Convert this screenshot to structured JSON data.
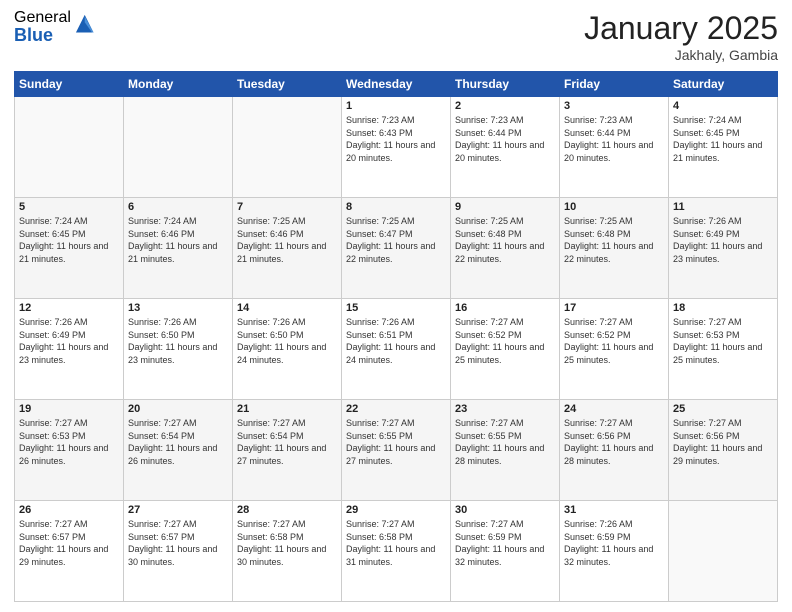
{
  "logo": {
    "general": "General",
    "blue": "Blue"
  },
  "header": {
    "month": "January 2025",
    "location": "Jakhaly, Gambia"
  },
  "weekdays": [
    "Sunday",
    "Monday",
    "Tuesday",
    "Wednesday",
    "Thursday",
    "Friday",
    "Saturday"
  ],
  "weeks": [
    [
      {
        "day": "",
        "sunrise": "",
        "sunset": "",
        "daylight": ""
      },
      {
        "day": "",
        "sunrise": "",
        "sunset": "",
        "daylight": ""
      },
      {
        "day": "",
        "sunrise": "",
        "sunset": "",
        "daylight": ""
      },
      {
        "day": "1",
        "sunrise": "Sunrise: 7:23 AM",
        "sunset": "Sunset: 6:43 PM",
        "daylight": "Daylight: 11 hours and 20 minutes."
      },
      {
        "day": "2",
        "sunrise": "Sunrise: 7:23 AM",
        "sunset": "Sunset: 6:44 PM",
        "daylight": "Daylight: 11 hours and 20 minutes."
      },
      {
        "day": "3",
        "sunrise": "Sunrise: 7:23 AM",
        "sunset": "Sunset: 6:44 PM",
        "daylight": "Daylight: 11 hours and 20 minutes."
      },
      {
        "day": "4",
        "sunrise": "Sunrise: 7:24 AM",
        "sunset": "Sunset: 6:45 PM",
        "daylight": "Daylight: 11 hours and 21 minutes."
      }
    ],
    [
      {
        "day": "5",
        "sunrise": "Sunrise: 7:24 AM",
        "sunset": "Sunset: 6:45 PM",
        "daylight": "Daylight: 11 hours and 21 minutes."
      },
      {
        "day": "6",
        "sunrise": "Sunrise: 7:24 AM",
        "sunset": "Sunset: 6:46 PM",
        "daylight": "Daylight: 11 hours and 21 minutes."
      },
      {
        "day": "7",
        "sunrise": "Sunrise: 7:25 AM",
        "sunset": "Sunset: 6:46 PM",
        "daylight": "Daylight: 11 hours and 21 minutes."
      },
      {
        "day": "8",
        "sunrise": "Sunrise: 7:25 AM",
        "sunset": "Sunset: 6:47 PM",
        "daylight": "Daylight: 11 hours and 22 minutes."
      },
      {
        "day": "9",
        "sunrise": "Sunrise: 7:25 AM",
        "sunset": "Sunset: 6:48 PM",
        "daylight": "Daylight: 11 hours and 22 minutes."
      },
      {
        "day": "10",
        "sunrise": "Sunrise: 7:25 AM",
        "sunset": "Sunset: 6:48 PM",
        "daylight": "Daylight: 11 hours and 22 minutes."
      },
      {
        "day": "11",
        "sunrise": "Sunrise: 7:26 AM",
        "sunset": "Sunset: 6:49 PM",
        "daylight": "Daylight: 11 hours and 23 minutes."
      }
    ],
    [
      {
        "day": "12",
        "sunrise": "Sunrise: 7:26 AM",
        "sunset": "Sunset: 6:49 PM",
        "daylight": "Daylight: 11 hours and 23 minutes."
      },
      {
        "day": "13",
        "sunrise": "Sunrise: 7:26 AM",
        "sunset": "Sunset: 6:50 PM",
        "daylight": "Daylight: 11 hours and 23 minutes."
      },
      {
        "day": "14",
        "sunrise": "Sunrise: 7:26 AM",
        "sunset": "Sunset: 6:50 PM",
        "daylight": "Daylight: 11 hours and 24 minutes."
      },
      {
        "day": "15",
        "sunrise": "Sunrise: 7:26 AM",
        "sunset": "Sunset: 6:51 PM",
        "daylight": "Daylight: 11 hours and 24 minutes."
      },
      {
        "day": "16",
        "sunrise": "Sunrise: 7:27 AM",
        "sunset": "Sunset: 6:52 PM",
        "daylight": "Daylight: 11 hours and 25 minutes."
      },
      {
        "day": "17",
        "sunrise": "Sunrise: 7:27 AM",
        "sunset": "Sunset: 6:52 PM",
        "daylight": "Daylight: 11 hours and 25 minutes."
      },
      {
        "day": "18",
        "sunrise": "Sunrise: 7:27 AM",
        "sunset": "Sunset: 6:53 PM",
        "daylight": "Daylight: 11 hours and 25 minutes."
      }
    ],
    [
      {
        "day": "19",
        "sunrise": "Sunrise: 7:27 AM",
        "sunset": "Sunset: 6:53 PM",
        "daylight": "Daylight: 11 hours and 26 minutes."
      },
      {
        "day": "20",
        "sunrise": "Sunrise: 7:27 AM",
        "sunset": "Sunset: 6:54 PM",
        "daylight": "Daylight: 11 hours and 26 minutes."
      },
      {
        "day": "21",
        "sunrise": "Sunrise: 7:27 AM",
        "sunset": "Sunset: 6:54 PM",
        "daylight": "Daylight: 11 hours and 27 minutes."
      },
      {
        "day": "22",
        "sunrise": "Sunrise: 7:27 AM",
        "sunset": "Sunset: 6:55 PM",
        "daylight": "Daylight: 11 hours and 27 minutes."
      },
      {
        "day": "23",
        "sunrise": "Sunrise: 7:27 AM",
        "sunset": "Sunset: 6:55 PM",
        "daylight": "Daylight: 11 hours and 28 minutes."
      },
      {
        "day": "24",
        "sunrise": "Sunrise: 7:27 AM",
        "sunset": "Sunset: 6:56 PM",
        "daylight": "Daylight: 11 hours and 28 minutes."
      },
      {
        "day": "25",
        "sunrise": "Sunrise: 7:27 AM",
        "sunset": "Sunset: 6:56 PM",
        "daylight": "Daylight: 11 hours and 29 minutes."
      }
    ],
    [
      {
        "day": "26",
        "sunrise": "Sunrise: 7:27 AM",
        "sunset": "Sunset: 6:57 PM",
        "daylight": "Daylight: 11 hours and 29 minutes."
      },
      {
        "day": "27",
        "sunrise": "Sunrise: 7:27 AM",
        "sunset": "Sunset: 6:57 PM",
        "daylight": "Daylight: 11 hours and 30 minutes."
      },
      {
        "day": "28",
        "sunrise": "Sunrise: 7:27 AM",
        "sunset": "Sunset: 6:58 PM",
        "daylight": "Daylight: 11 hours and 30 minutes."
      },
      {
        "day": "29",
        "sunrise": "Sunrise: 7:27 AM",
        "sunset": "Sunset: 6:58 PM",
        "daylight": "Daylight: 11 hours and 31 minutes."
      },
      {
        "day": "30",
        "sunrise": "Sunrise: 7:27 AM",
        "sunset": "Sunset: 6:59 PM",
        "daylight": "Daylight: 11 hours and 32 minutes."
      },
      {
        "day": "31",
        "sunrise": "Sunrise: 7:26 AM",
        "sunset": "Sunset: 6:59 PM",
        "daylight": "Daylight: 11 hours and 32 minutes."
      },
      {
        "day": "",
        "sunrise": "",
        "sunset": "",
        "daylight": ""
      }
    ]
  ]
}
